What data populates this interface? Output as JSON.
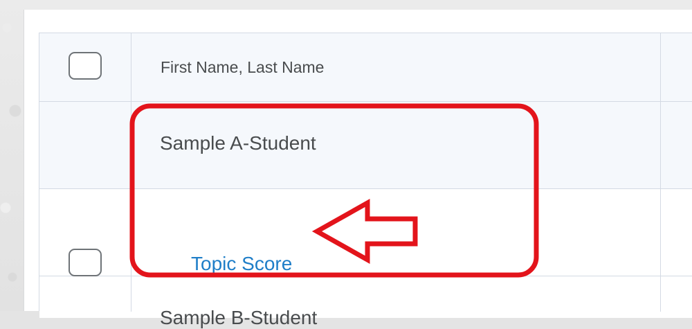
{
  "table": {
    "header": {
      "name_column": "First Name, Last Name"
    },
    "rows": [
      {
        "student_name": "Sample A-Student",
        "item_link": "Topic Score"
      },
      {
        "student_name": "Sample B-Student"
      }
    ]
  },
  "annotation": {
    "color": "#e3141b"
  }
}
